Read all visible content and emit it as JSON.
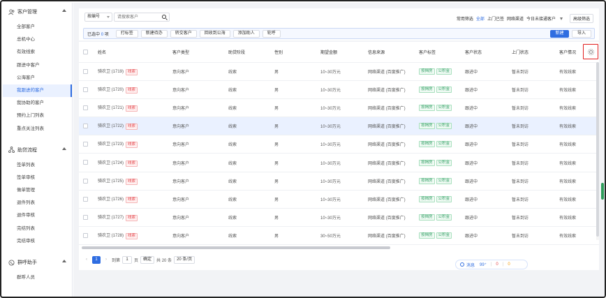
{
  "sidebar": {
    "groups": [
      {
        "title": "客户管理",
        "icon": "users-icon",
        "items": [
          "全部客户",
          "总机中心",
          "有效线索",
          "跟进中客户",
          "公海客户",
          "我跟进的客户",
          "我协助的客户",
          "预约上门列表",
          "重点关注列表"
        ],
        "active": 5
      },
      {
        "title": "助贷流程",
        "icon": "workflow-icon",
        "items": [
          "签单列表",
          "签单审核",
          "做单管理",
          "退件列表",
          "退件审核",
          "完结列表",
          "完结审核"
        ]
      },
      {
        "title": "群呼助手",
        "icon": "phone-icon",
        "items": [
          "群呼人员"
        ]
      }
    ]
  },
  "topbar": {
    "select_label": "按编号",
    "search_placeholder": "请搜索客户",
    "filter_label": "常用筛选",
    "filters": [
      "全部",
      "上门已签",
      "网络渠道",
      "今日未接通客户"
    ],
    "advanced": "高级筛选"
  },
  "toolbar": {
    "selected_prefix": "已选中",
    "selected_count": "0",
    "selected_suffix": "项",
    "buttons": [
      "打标签",
      "新建待办",
      "转交客户",
      "回收到公海",
      "添加助人",
      "轮呼"
    ],
    "new_label": "新建",
    "import_label": "导入"
  },
  "table": {
    "columns": [
      "姓名",
      "客户类型",
      "助贷阶段",
      "性别",
      "期望金额",
      "信息来源",
      "客户标签",
      "客户状态",
      "上门状态",
      "客户情况"
    ],
    "rows": [
      {
        "name": "骑农卫 (1719)",
        "tag": "线索",
        "type": "意向客户",
        "stage": "线索",
        "gender": "男",
        "amount": "10~30万元",
        "source": "网络渠道 (百度推广)",
        "labels": [
          "按揭房",
          "公积金"
        ],
        "status": "跟进中",
        "visit": "暂未到访",
        "situation": "有效线索"
      },
      {
        "name": "骑农卫 (1720)",
        "tag": "线索",
        "type": "意向客户",
        "stage": "线索",
        "gender": "男",
        "amount": "10~30万元",
        "source": "网络渠道 (百度推广)",
        "labels": [
          "按揭房",
          "公积金"
        ],
        "status": "跟进中",
        "visit": "暂未到访",
        "situation": "有效线索"
      },
      {
        "name": "骑农卫 (1721)",
        "tag": "线索",
        "type": "意向客户",
        "stage": "线索",
        "gender": "男",
        "amount": "10~30万元",
        "source": "网络渠道 (百度推广)",
        "labels": [
          "按揭房",
          "公积金"
        ],
        "status": "跟进中",
        "visit": "暂未到访",
        "situation": "有效线索"
      },
      {
        "name": "骑农卫 (1722)",
        "tag": "线索",
        "type": "意向客户",
        "stage": "线索",
        "gender": "男",
        "amount": "10~30万元",
        "source": "网络渠道 (百度推广)",
        "labels": [
          "按揭房",
          "公积金"
        ],
        "status": "跟进中",
        "visit": "暂未到访",
        "situation": "有效线索"
      },
      {
        "name": "骑农卫 (1723)",
        "tag": "线索",
        "type": "意向客户",
        "stage": "线索",
        "gender": "男",
        "amount": "10~30万元",
        "source": "网络渠道 (百度推广)",
        "labels": [
          "按揭房",
          "公积金"
        ],
        "status": "跟进中",
        "visit": "暂未到访",
        "situation": "有效线索"
      },
      {
        "name": "骑农卫 (1724)",
        "tag": "线索",
        "type": "意向客户",
        "stage": "线索",
        "gender": "男",
        "amount": "10~30万元",
        "source": "网络渠道 (百度推广)",
        "labels": [
          "按揭房",
          "公积金"
        ],
        "status": "跟进中",
        "visit": "暂未到访",
        "situation": "有效线索"
      },
      {
        "name": "骑农卫 (1725)",
        "tag": "线索",
        "type": "意向客户",
        "stage": "线索",
        "gender": "男",
        "amount": "10~30万元",
        "source": "网络渠道 (百度推广)",
        "labels": [
          "按揭房",
          "公积金"
        ],
        "status": "跟进中",
        "visit": "暂未到访",
        "situation": "有效线索"
      },
      {
        "name": "骑农卫 (1726)",
        "tag": "线索",
        "type": "意向客户",
        "stage": "线索",
        "gender": "男",
        "amount": "10~30万元",
        "source": "网络渠道 (百度推广)",
        "labels": [
          "按揭房",
          "公积金"
        ],
        "status": "跟进中",
        "visit": "暂未到访",
        "situation": "有效线索"
      },
      {
        "name": "骑农卫 (1727)",
        "tag": "线索",
        "type": "意向客户",
        "stage": "线索",
        "gender": "男",
        "amount": "10~30万元",
        "source": "网络渠道 (百度推广)",
        "labels": [
          "按揭房",
          "公积金"
        ],
        "status": "跟进中",
        "visit": "暂未到访",
        "situation": "有效线索"
      },
      {
        "name": "骑农卫 (1728)",
        "tag": "线索",
        "type": "意向客户",
        "stage": "线索",
        "gender": "男",
        "amount": "30~50万元",
        "source": "网络渠道 (百度推广)",
        "labels": [
          "按揭房",
          "公积金"
        ],
        "status": "跟进中",
        "visit": "暂未到访",
        "situation": "有效线索"
      }
    ],
    "highlight_row": 3
  },
  "pager": {
    "current": "1",
    "goto_label": "到第",
    "goto_value": "1",
    "page_unit": "页",
    "confirm": "确定",
    "total": "共 20 条",
    "size": "20 条/页"
  },
  "messages": {
    "label": "消息",
    "count1": "99⁺",
    "count2": "0",
    "count3": "0"
  },
  "colors": {
    "accent": "#2f6de1",
    "tag_red": "#e5484d",
    "tag_green": "#38a169",
    "highlight_box": "#e11d1d"
  }
}
